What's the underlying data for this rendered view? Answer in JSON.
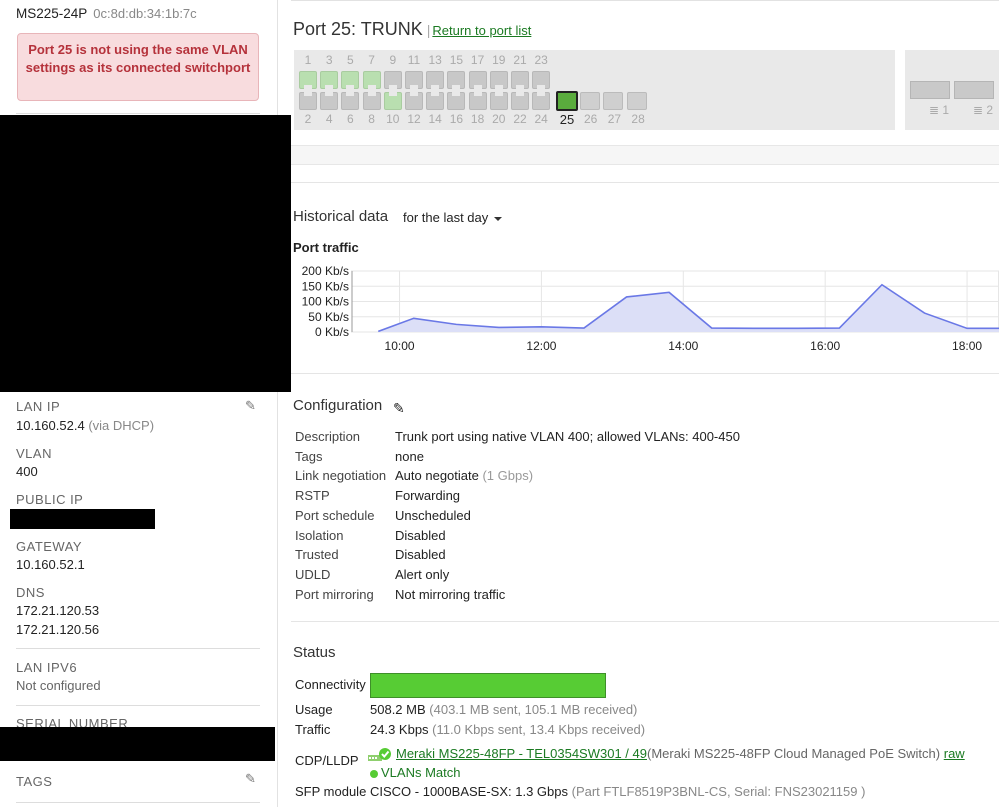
{
  "device": {
    "model": "MS225-24P",
    "mac": "0c:8d:db:34:1b:7c"
  },
  "alert": "Port 25 is not using the same VLAN settings as its connected switchport",
  "sidebar": {
    "lan_ip_label": "LAN IP",
    "lan_ip": "10.160.52.4",
    "lan_ip_note": "(via DHCP)",
    "vlan_label": "VLAN",
    "vlan": "400",
    "public_ip_label": "PUBLIC IP",
    "gateway_label": "GATEWAY",
    "gateway": "10.160.52.1",
    "dns_label": "DNS",
    "dns1": "172.21.120.53",
    "dns2": "172.21.120.56",
    "lan_ipv6_label": "LAN IPV6",
    "lan_ipv6": "Not configured",
    "serial_label": "SERIAL NUMBER",
    "tags_label": "TAGS"
  },
  "header": {
    "port_title": "Port 25: TRUNK",
    "pipe": "|",
    "return_link": "Return to port list"
  },
  "switch": {
    "top_labels": [
      "1",
      "3",
      "5",
      "7",
      "9",
      "11",
      "13",
      "15",
      "17",
      "19",
      "21",
      "23"
    ],
    "bottom_labels": [
      "2",
      "4",
      "6",
      "8",
      "10",
      "12",
      "14",
      "16",
      "18",
      "20",
      "22",
      "24"
    ],
    "sfp_labels": [
      "25",
      "26",
      "27",
      "28"
    ],
    "selected_port": "25",
    "uplink_labels": [
      "1",
      "2"
    ],
    "up_ports": [
      "1",
      "3",
      "5",
      "7",
      "10"
    ]
  },
  "historical": {
    "title": "Historical data",
    "range": "for the last day"
  },
  "chart_data": {
    "type": "area",
    "title": "Port traffic",
    "ylabel": "",
    "xlabel": "",
    "y_ticks": [
      "200 Kb/s",
      "150 Kb/s",
      "100 Kb/s",
      "50 Kb/s",
      "0 Kb/s"
    ],
    "ylim": [
      0,
      200
    ],
    "x_ticks": [
      "10:00",
      "12:00",
      "14:00",
      "16:00",
      "18:00"
    ],
    "xlim_hours": [
      9.33,
      18.45
    ],
    "points": [
      {
        "x": 9.7,
        "y": 2
      },
      {
        "x": 10.2,
        "y": 45
      },
      {
        "x": 10.8,
        "y": 25
      },
      {
        "x": 11.4,
        "y": 15
      },
      {
        "x": 12.0,
        "y": 17
      },
      {
        "x": 12.6,
        "y": 13
      },
      {
        "x": 13.2,
        "y": 115
      },
      {
        "x": 13.8,
        "y": 130
      },
      {
        "x": 14.4,
        "y": 13
      },
      {
        "x": 15.0,
        "y": 12
      },
      {
        "x": 15.6,
        "y": 12
      },
      {
        "x": 16.2,
        "y": 13
      },
      {
        "x": 16.8,
        "y": 155
      },
      {
        "x": 17.4,
        "y": 62
      },
      {
        "x": 18.0,
        "y": 12
      },
      {
        "x": 18.45,
        "y": 12
      }
    ]
  },
  "configuration": {
    "title": "Configuration",
    "rows": [
      {
        "k": "Description",
        "v": "Trunk port using native VLAN 400; allowed VLANs: 400-450",
        "note": ""
      },
      {
        "k": "Tags",
        "v": "none",
        "note": ""
      },
      {
        "k": "Link negotiation",
        "v": "Auto negotiate",
        "note": "(1 Gbps)"
      },
      {
        "k": "RSTP",
        "v": "Forwarding",
        "note": ""
      },
      {
        "k": "Port schedule",
        "v": "Unscheduled",
        "note": ""
      },
      {
        "k": "Isolation",
        "v": "Disabled",
        "note": ""
      },
      {
        "k": "Trusted",
        "v": "Disabled",
        "note": ""
      },
      {
        "k": "UDLD",
        "v": "Alert only",
        "note": ""
      },
      {
        "k": "Port mirroring",
        "v": "Not mirroring traffic",
        "note": ""
      }
    ]
  },
  "status": {
    "title": "Status",
    "connectivity_label": "Connectivity",
    "usage_label": "Usage",
    "usage": "508.2 MB",
    "usage_note": "(403.1 MB sent, 105.1 MB received)",
    "traffic_label": "Traffic",
    "traffic": "24.3 Kbps",
    "traffic_note": "(11.0 Kbps sent, 13.4 Kbps received)",
    "cdp_label": "CDP/LLDP",
    "cdp_link": "Meraki MS225-48FP - TEL0354SW301 / 49",
    "cdp_desc": "(Meraki MS225-48FP Cloud Managed PoE Switch)",
    "cdp_raw": "raw",
    "vlans_match": "VLANs Match",
    "sfp_label": "SFP module",
    "sfp_value": "CISCO - 1000BASE-SX: 1.3 Gbps",
    "sfp_note": "(Part FTLF8519P3BNL-CS, Serial: FNS23021159 )",
    "colors": {
      "connectivity": "#57cc34",
      "link": "#1b7a22"
    }
  },
  "colors": {
    "alert_bg": "#f8dcde",
    "alert_text": "#b5323b",
    "series_line": "#6a78e6",
    "series_fill": "#dcdff7"
  }
}
